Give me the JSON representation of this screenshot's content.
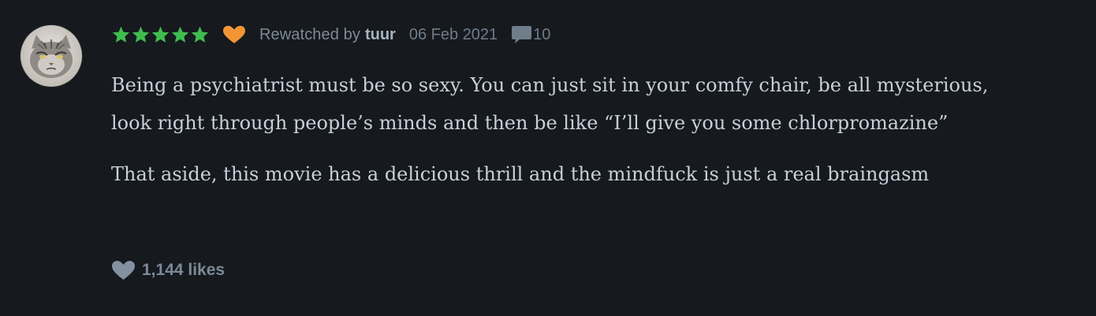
{
  "review": {
    "rating_stars": 5,
    "liked": true,
    "context_label": "Rewatched by",
    "username": "tuur",
    "date": "06 Feb 2021",
    "comment_count": "10",
    "paragraphs": [
      "Being a psychiatrist must be so sexy. You can just sit in your comfy chair, be all mysterious, look right through people’s minds and then be like “I’ll give you some chlorpromazine”",
      "That aside, this movie has a delicious thrill and the mindfuck is just a real braingasm"
    ],
    "likes_label": "1,144 likes"
  },
  "colors": {
    "background": "#16191e",
    "star_green": "#40bc4f",
    "heart_orange": "#f29535",
    "muted_text": "#7d8a98",
    "body_text": "#c7d0d9"
  },
  "icons": {
    "stars": "star-icon",
    "like": "heart-icon",
    "comments": "speech-bubble-icon",
    "likes": "heart-icon"
  }
}
